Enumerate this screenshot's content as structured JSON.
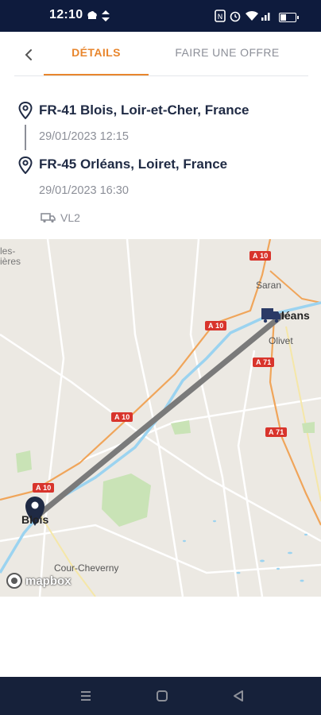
{
  "status_bar": {
    "time": "12:10",
    "icons": [
      "chef-hat-icon",
      "sync-icon",
      "nfc-icon",
      "alarm-icon",
      "wifi-icon",
      "signal-icon",
      "battery-icon"
    ]
  },
  "tabs": {
    "back_icon": "chevron-left-icon",
    "items": [
      {
        "label": "DÉTAILS",
        "active": true
      },
      {
        "label": "FAIRE UNE OFFRE",
        "active": false
      }
    ]
  },
  "route": {
    "origin": {
      "name": "FR-41 Blois, Loir-et-Cher, France",
      "datetime": "29/01/2023 12:15"
    },
    "destination": {
      "name": "FR-45 Orléans, Loiret, France",
      "datetime": "29/01/2023 16:30"
    },
    "vehicle": {
      "icon": "truck-icon",
      "label": "VL2"
    }
  },
  "map": {
    "labels": {
      "saran": "Saran",
      "olivet": "Olivet",
      "orleans": "léans",
      "blois": "Blois",
      "cour_cheverny": "Cour-Cheverny",
      "partial_top_left_1": "les-",
      "partial_top_left_2": "ières"
    },
    "road_shields": [
      "A 10",
      "A 10",
      "A 71",
      "A 10",
      "A 71",
      "A 10"
    ],
    "attribution": "mapbox",
    "colors": {
      "route": "#7a7a7a",
      "pin": "#1f2a44",
      "truck": "#2a3a66",
      "water": "#9bd3f0",
      "forest": "#c9e3b6",
      "motorway": "#e8862d"
    }
  },
  "navbar": {
    "icons": [
      "recent-apps-icon",
      "home-icon",
      "back-icon"
    ]
  },
  "colors": {
    "accent": "#e8862d",
    "primary_text": "#1f2a44",
    "secondary_text": "#8c8f98",
    "status_bar": "#0e1b3d"
  }
}
